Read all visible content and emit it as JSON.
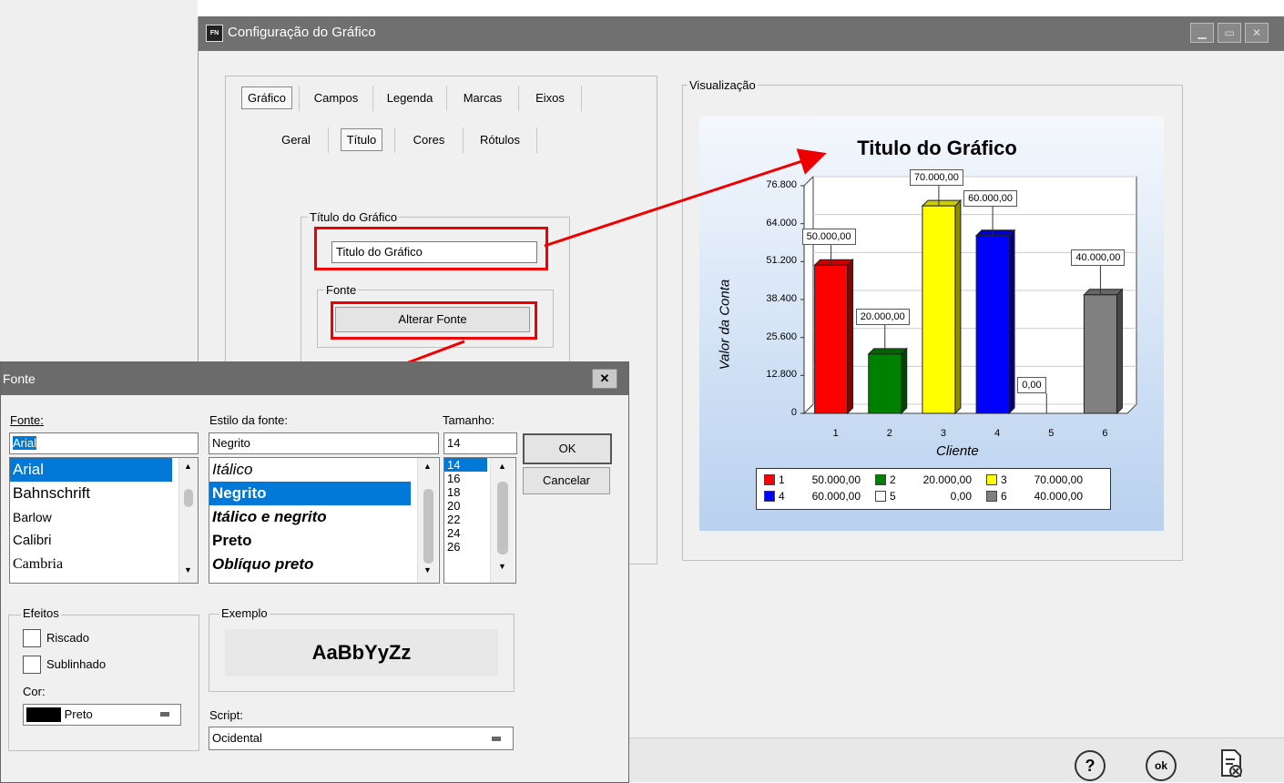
{
  "main_window": {
    "title": "Configuração do Gráfico",
    "app_icon": "FN",
    "tabs": [
      "Gráfico",
      "Campos",
      "Legenda",
      "Marcas",
      "Eixos"
    ],
    "subtabs": [
      "Geral",
      "Título",
      "Cores",
      "Rótulos"
    ],
    "titulo_group_label": "Título do Gráfico",
    "titulo_value": "Titulo do Gráfico",
    "fonte_group_label": "Fonte",
    "alterar_fonte_label": "Alterar Fonte",
    "visualizacao_label": "Visualização"
  },
  "font_dialog": {
    "title": "Fonte",
    "fonte_label": "Fonte:",
    "fonte_value": "Arial",
    "fonte_list": [
      "Arial",
      "Bahnschrift",
      "Barlow",
      "Calibri",
      "Cambria"
    ],
    "estilo_label": "Estilo da fonte:",
    "estilo_value": "Negrito",
    "estilo_list": [
      "Itálico",
      "Negrito",
      "Itálico e negrito",
      "Preto",
      "Oblíquo preto"
    ],
    "tamanho_label": "Tamanho:",
    "tamanho_value": "14",
    "tamanho_list": [
      "14",
      "16",
      "18",
      "20",
      "22",
      "24",
      "26"
    ],
    "ok_label": "OK",
    "cancelar_label": "Cancelar",
    "efeitos_label": "Efeitos",
    "riscado_label": "Riscado",
    "sublinhado_label": "Sublinhado",
    "cor_label": "Cor:",
    "cor_value": "Preto",
    "exemplo_label": "Exemplo",
    "exemplo_text": "AaBbYyZz",
    "script_label": "Script:",
    "script_value": "Ocidental"
  },
  "chart_data": {
    "type": "bar",
    "title": "Titulo do Gráfico",
    "xlabel": "Cliente",
    "ylabel": "Valor da Conta",
    "categories": [
      "1",
      "2",
      "3",
      "4",
      "5",
      "6"
    ],
    "values": [
      50000,
      20000,
      70000,
      60000,
      0,
      40000
    ],
    "value_labels": [
      "50.000,00",
      "20.000,00",
      "70.000,00",
      "60.000,00",
      "0,00",
      "40.000,00"
    ],
    "colors": [
      "#ff0000",
      "#008000",
      "#ffff00",
      "#0000ff",
      "#ffffff",
      "#808080"
    ],
    "yticks": [
      "0",
      "12.800",
      "25.600",
      "38.400",
      "51.200",
      "64.000",
      "76.800"
    ],
    "ylim": [
      0,
      76800
    ],
    "legend": [
      {
        "num": "1",
        "value": "50.000,00"
      },
      {
        "num": "2",
        "value": "20.000,00"
      },
      {
        "num": "3",
        "value": "70.000,00"
      },
      {
        "num": "4",
        "value": "60.000,00"
      },
      {
        "num": "5",
        "value": "0,00"
      },
      {
        "num": "6",
        "value": "40.000,00"
      }
    ]
  },
  "bottom_bar": {
    "help_icon": "?",
    "ok_icon": "ok"
  }
}
